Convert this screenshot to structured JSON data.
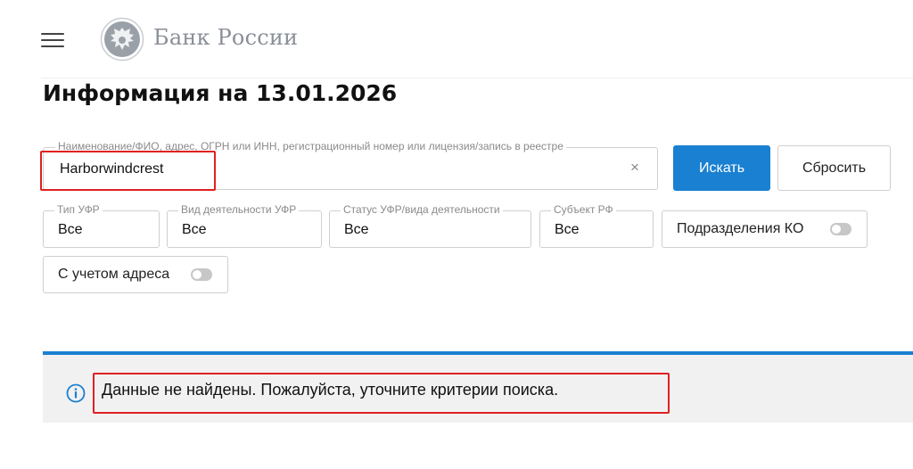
{
  "header": {
    "brand": "Банк России",
    "menu_icon": "hamburger-menu-icon",
    "logo_icon": "double-headed-eagle-emblem"
  },
  "page": {
    "title": "Информация на 13.01.2026"
  },
  "search": {
    "label": "Наименование/ФИО, адрес, ОГРН или ИНН, регистрационный номер или лицензия/запись в реестре",
    "value": "Harborwindcrest",
    "clear_icon": "close-icon",
    "search_button": "Искать",
    "reset_button": "Сбросить"
  },
  "filters": [
    {
      "label": "Тип УФР",
      "value": "Все"
    },
    {
      "label": "Вид деятельности УФР",
      "value": "Все"
    },
    {
      "label": "Статус УФР/вида деятельности",
      "value": "Все"
    },
    {
      "label": "Субъект РФ",
      "value": "Все"
    }
  ],
  "toggles": {
    "ko_subdivisions": {
      "label": "Подразделения КО",
      "on": false
    },
    "with_address": {
      "label": "С учетом адреса",
      "on": false
    }
  },
  "result": {
    "icon": "info-icon",
    "message": "Данные не найдены. Пожалуйста, уточните критерии поиска."
  },
  "colors": {
    "accent": "#1a80d1",
    "highlight": "#e02020",
    "info_bg": "#f1f1f2"
  }
}
